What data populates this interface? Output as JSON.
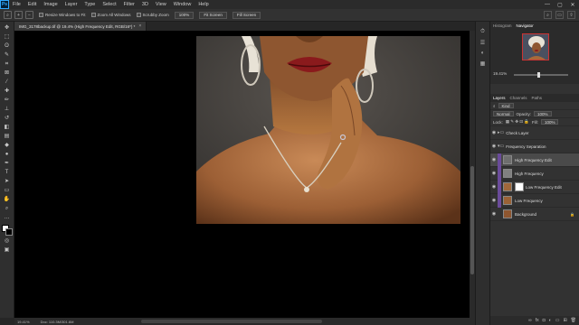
{
  "menubar": {
    "logo": "Ps",
    "items": [
      "File",
      "Edit",
      "Image",
      "Layer",
      "Type",
      "Select",
      "Filter",
      "3D",
      "View",
      "Window",
      "Help"
    ],
    "window_controls": [
      "—",
      "▢",
      "✕"
    ]
  },
  "optbar": {
    "tool_icon": "zoom-icon",
    "resize_windows": "Resize Windows to Fit",
    "zoom_all_windows": "Zoom All Windows",
    "scrubby_zoom": "Scrubby Zoom",
    "btn_100": "100%",
    "fit_screen": "Fit Screen",
    "fill_screen": "Fill Screen"
  },
  "document": {
    "tab_title": "IMG_3178backup.tif @ 19.4% (High Frequency Edit, RGB/16*) *",
    "zoom": "19.41%",
    "doc_info": "Doc: 110.3M/301.6M"
  },
  "panels": {
    "top_tabs": [
      "Histogram",
      "Navigator"
    ],
    "active_top_tab": "Navigator",
    "nav_zoom": "19.41%",
    "layer_tabs": [
      "Layers",
      "Channels",
      "Paths"
    ],
    "active_layer_tab": "Layers",
    "kind_label": "Kind",
    "blend_mode": "Normal",
    "opacity_label": "Opacity:",
    "opacity_value": "100%",
    "lock_label": "Lock:",
    "fill_label": "Fill:",
    "fill_value": "100%",
    "layers": [
      {
        "name": "Check Layer",
        "type": "group"
      },
      {
        "name": "Frequency Separation",
        "type": "group"
      },
      {
        "name": "High Frequency Edit",
        "type": "layer"
      },
      {
        "name": "High Frequency",
        "type": "layer"
      },
      {
        "name": "Low Frequency Edit",
        "type": "layer"
      },
      {
        "name": "Low Frequency",
        "type": "layer"
      },
      {
        "name": "Background",
        "type": "layer"
      }
    ]
  },
  "colors": {
    "selection": "#4a4a4a",
    "purple_label": "#6a4b9a",
    "lipstick": "#8a1a1c"
  }
}
